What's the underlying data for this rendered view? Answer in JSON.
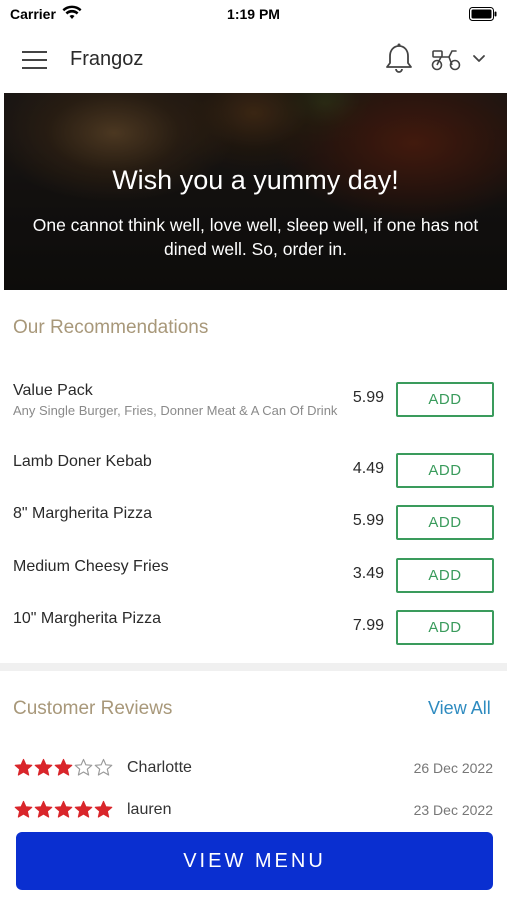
{
  "status_bar": {
    "carrier": "Carrier",
    "time": "1:19 PM"
  },
  "header": {
    "title": "Frangoz",
    "icons": [
      "hamburger-icon",
      "bell-icon",
      "scooter-icon",
      "chevron-down-icon"
    ]
  },
  "hero": {
    "title": "Wish you a yummy day!",
    "subtitle": "One cannot think well, love well, sleep well, if one has not dined well. So, order in."
  },
  "recommendations": {
    "title": "Our Recommendations",
    "add_label": "ADD",
    "items": [
      {
        "name": "Value Pack",
        "description": "Any Single Burger, Fries, Donner Meat & A Can Of Drink",
        "price": "5.99"
      },
      {
        "name": "Lamb Doner Kebab",
        "description": "",
        "price": "4.49"
      },
      {
        "name": "8\" Margherita Pizza",
        "description": "",
        "price": "5.99"
      },
      {
        "name": "Medium Cheesy Fries",
        "description": "",
        "price": "3.49"
      },
      {
        "name": "10\" Margherita Pizza",
        "description": "",
        "price": "7.99"
      }
    ]
  },
  "reviews": {
    "title": "Customer Reviews",
    "view_all": "View All",
    "items": [
      {
        "name": "Charlotte",
        "date": "26 Dec 2022",
        "rating": 3,
        "max_rating": 5
      },
      {
        "name": "lauren",
        "date": "23 Dec 2022",
        "rating": 5,
        "max_rating": 5
      }
    ]
  },
  "footer": {
    "button": "VIEW MENU"
  },
  "colors": {
    "accent_green": "#3a9b5c",
    "star_red": "#d9262b",
    "button_blue": "#0a2fd0",
    "section_title": "#a8987a",
    "link_blue": "#2e8bc0"
  }
}
